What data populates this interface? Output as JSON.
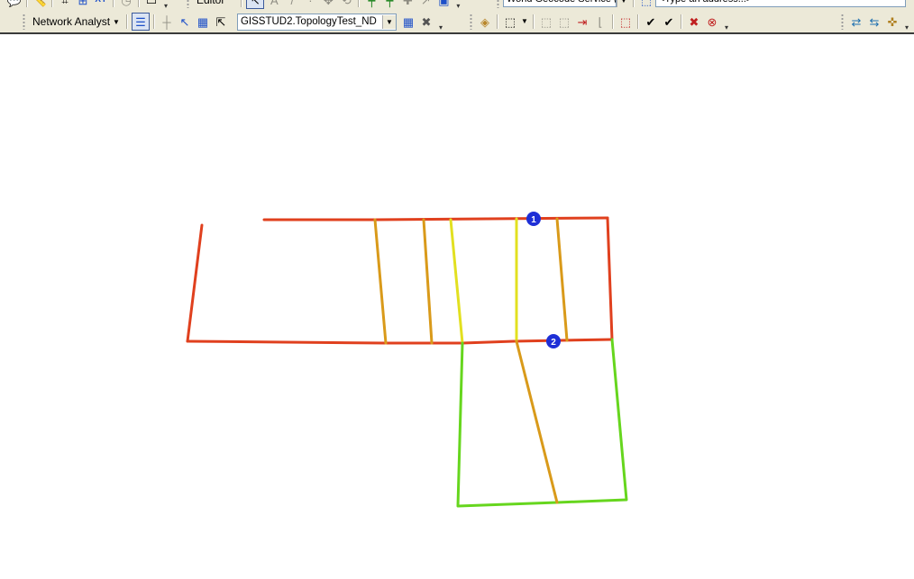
{
  "toolbar_row1": {
    "editor_label": "Editor",
    "geocoder_value": "World Geocode Service (",
    "address_placeholder": "<Type an address...>"
  },
  "network_analyst_toolbar": {
    "menu_label": "Network Analyst",
    "network_dataset_value": "GISSTUD2.TopologyTest_ND",
    "buttons": [
      {
        "icon": "network-analyst-window-icon",
        "active": true
      },
      {
        "icon": "create-network-location-icon",
        "enabled": false
      },
      {
        "icon": "select-move-network-location-icon"
      },
      {
        "icon": "network-identify-icon"
      },
      {
        "icon": "solve-icon"
      },
      {
        "icon": "build-network-dataset-icon"
      },
      {
        "icon": "network-dataset-properties-icon"
      }
    ]
  },
  "topology_toolbar": {
    "buttons": [
      "map-topology-icon",
      "topology-edit-tool-icon",
      "show-shared-features-icon",
      "construct-features-icon",
      "planarize-icon",
      "fix-topology-error-icon",
      "validate-topology-in-area-icon",
      "validate-topology-in-extent-icon",
      "error-inspector-icon",
      "error-inspector-delete-icon"
    ]
  },
  "edge_toolbar": {
    "buttons": [
      "flip-edge-icon",
      "edge-table-icon",
      "add-junction-icon"
    ]
  },
  "map": {
    "colors": {
      "red": "#e0401e",
      "orange": "#d99a1a",
      "yellow": "#e2e020",
      "green": "#66d61e",
      "stop": "#1e2fd6"
    },
    "stops": [
      {
        "label": "1"
      },
      {
        "label": "2"
      }
    ]
  }
}
